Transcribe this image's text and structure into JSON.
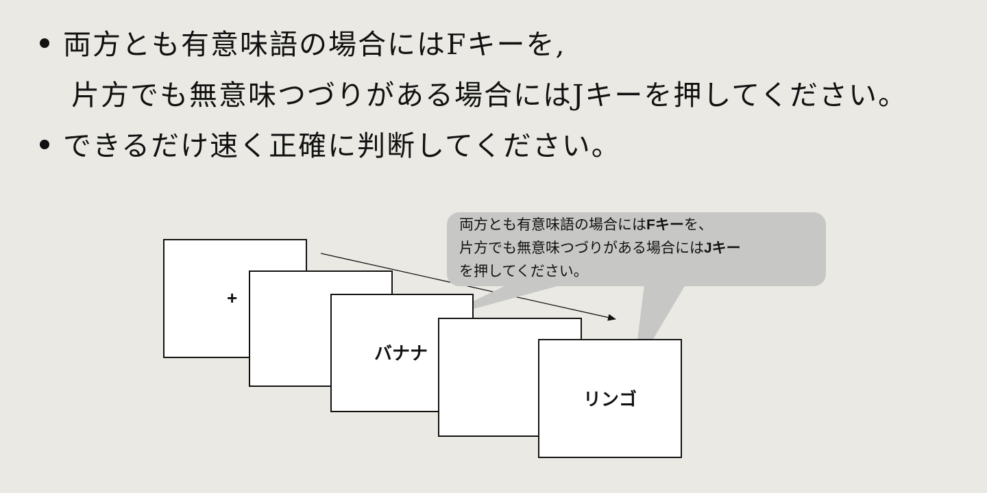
{
  "instructions": {
    "bullet1_line1": "両方とも有意味語の場合にはFキーを,",
    "bullet1_line2": "片方でも無意味つづりがある場合にはJキーを押してください。",
    "bullet2": "できるだけ速く正確に判断してください。"
  },
  "diagram": {
    "frames": [
      {
        "label": "+"
      },
      {
        "label": ""
      },
      {
        "label": "バナナ"
      },
      {
        "label": ""
      },
      {
        "label": "リンゴ"
      }
    ],
    "callout": {
      "line1_pre": "両方とも有意味語の場合には",
      "line1_key": "Fキー",
      "line1_post": "を、",
      "line2_pre": "片方でも無意味つづりがある場合には",
      "line2_key": "Jキー",
      "line3": "を押してください。"
    },
    "colors": {
      "background": "#eae9e3",
      "frame_fill": "#ffffff",
      "callout_fill": "#c7c7c5"
    }
  }
}
